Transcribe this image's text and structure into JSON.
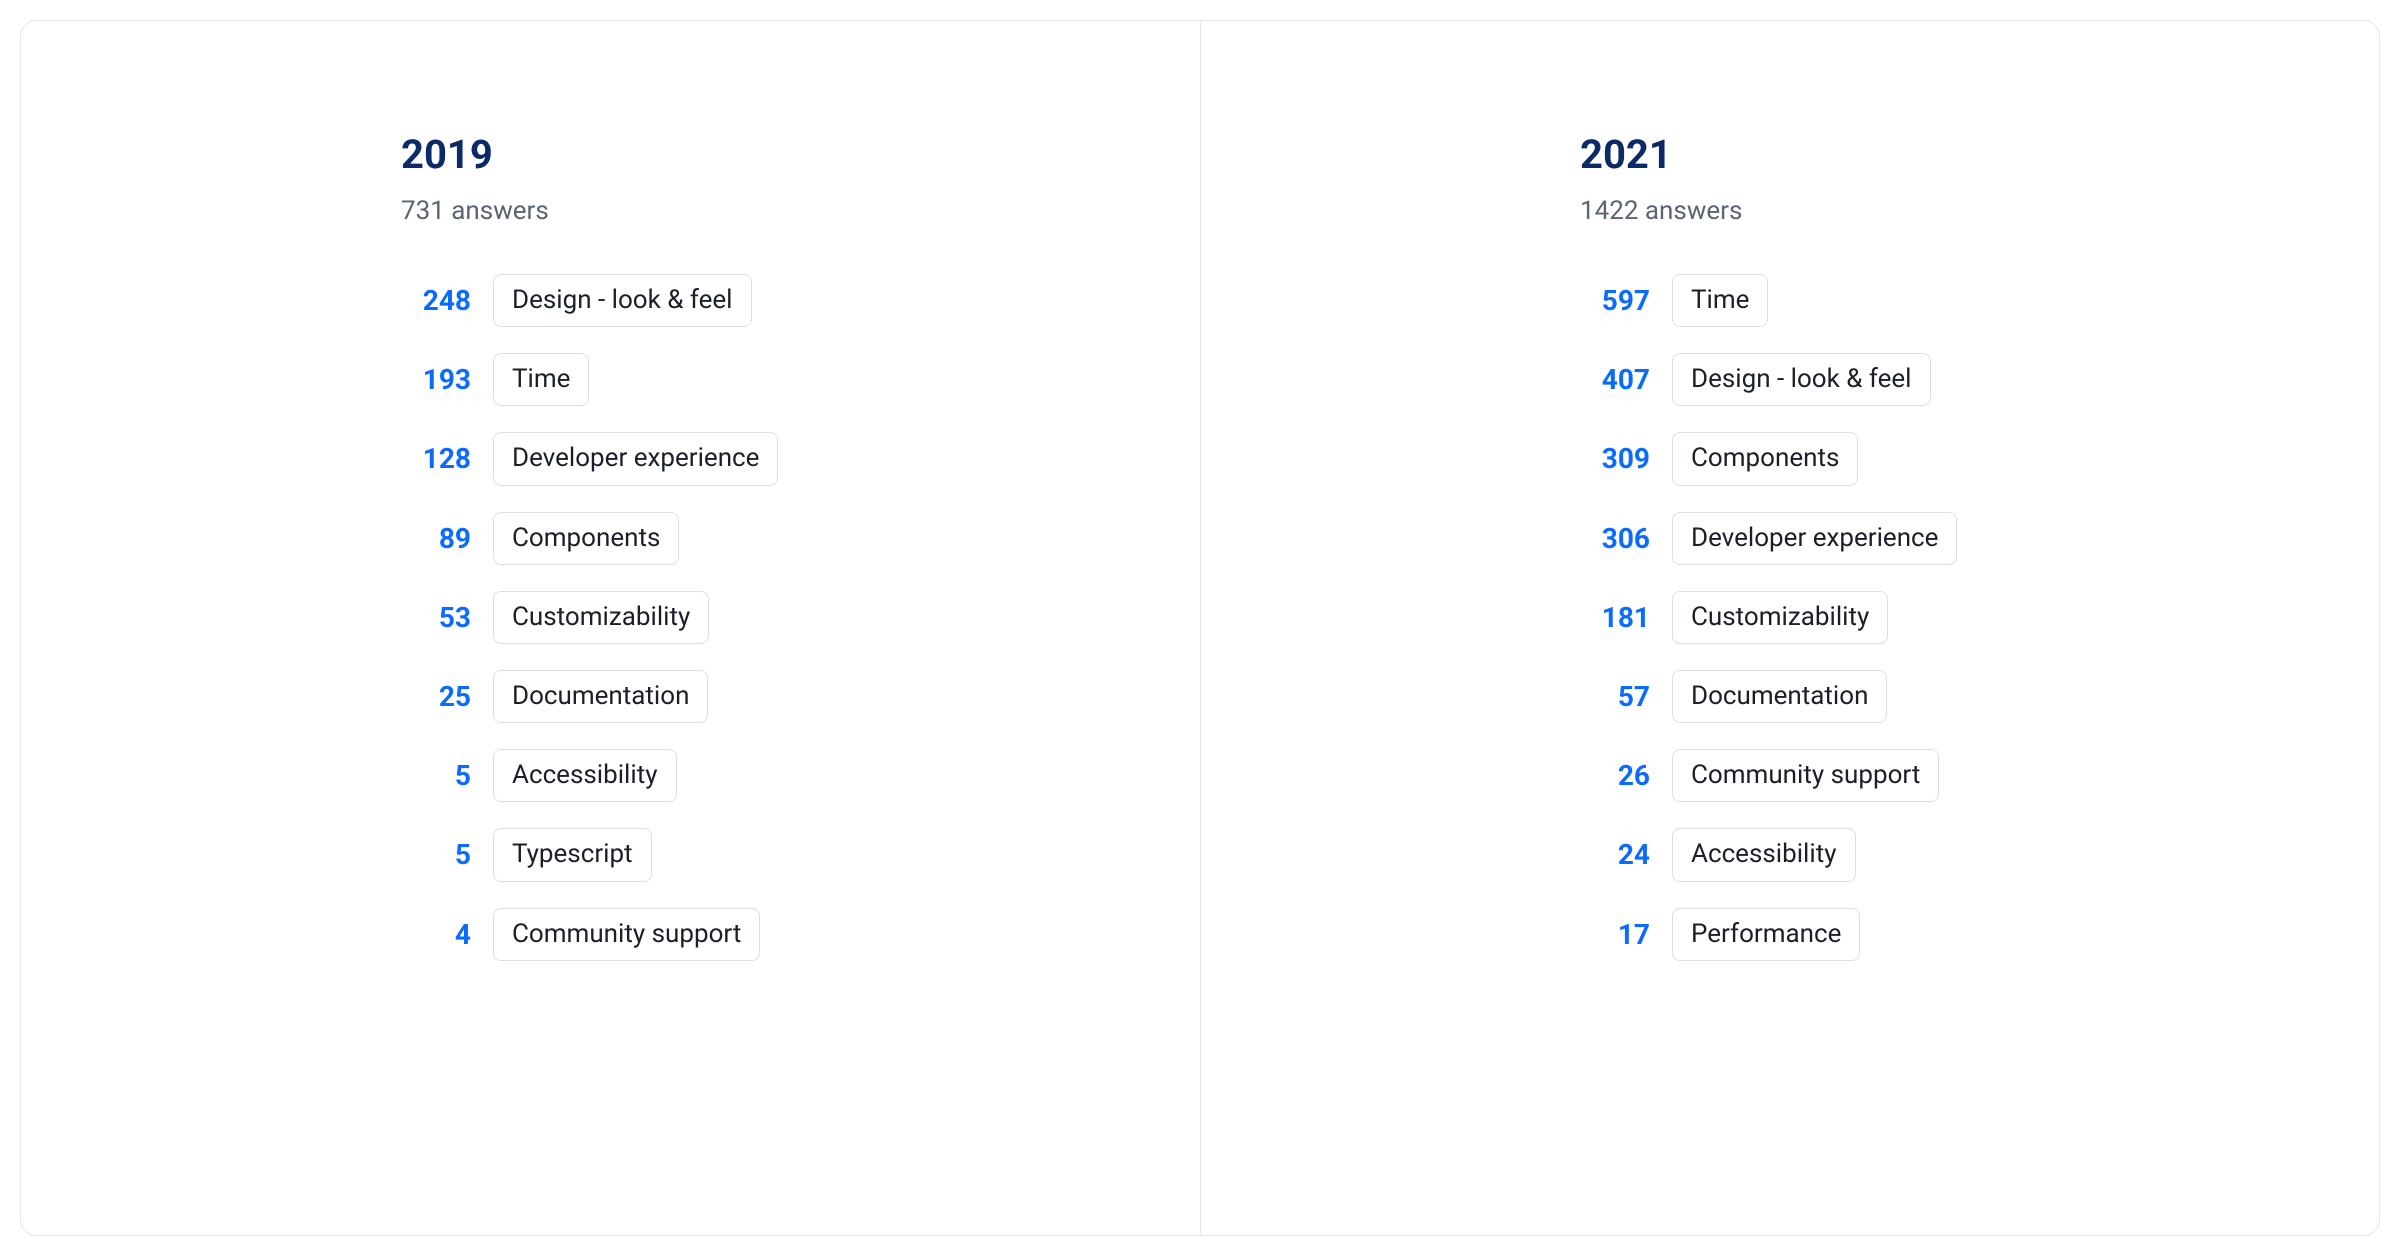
{
  "chart_data": [
    {
      "type": "bar",
      "title": "2019",
      "subtitle": "731 answers",
      "categories": [
        "Design - look & feel",
        "Time",
        "Developer experience",
        "Components",
        "Customizability",
        "Documentation",
        "Accessibility",
        "Typescript",
        "Community support"
      ],
      "values": [
        248,
        193,
        128,
        89,
        53,
        25,
        5,
        5,
        4
      ]
    },
    {
      "type": "bar",
      "title": "2021",
      "subtitle": "1422 answers",
      "categories": [
        "Time",
        "Design - look & feel",
        "Components",
        "Developer experience",
        "Customizability",
        "Documentation",
        "Community support",
        "Accessibility",
        "Performance"
      ],
      "values": [
        597,
        407,
        309,
        306,
        181,
        57,
        26,
        24,
        17
      ]
    }
  ],
  "panels": [
    {
      "title": "2019",
      "subtitle": "731 answers",
      "items": [
        {
          "count": "248",
          "label": "Design - look & feel"
        },
        {
          "count": "193",
          "label": "Time"
        },
        {
          "count": "128",
          "label": "Developer experience"
        },
        {
          "count": "89",
          "label": "Components"
        },
        {
          "count": "53",
          "label": "Customizability"
        },
        {
          "count": "25",
          "label": "Documentation"
        },
        {
          "count": "5",
          "label": "Accessibility"
        },
        {
          "count": "5",
          "label": "Typescript"
        },
        {
          "count": "4",
          "label": "Community support"
        }
      ]
    },
    {
      "title": "2021",
      "subtitle": "1422 answers",
      "items": [
        {
          "count": "597",
          "label": "Time"
        },
        {
          "count": "407",
          "label": "Design - look & feel"
        },
        {
          "count": "309",
          "label": "Components"
        },
        {
          "count": "306",
          "label": "Developer experience"
        },
        {
          "count": "181",
          "label": "Customizability"
        },
        {
          "count": "57",
          "label": "Documentation"
        },
        {
          "count": "26",
          "label": "Community support"
        },
        {
          "count": "24",
          "label": "Accessibility"
        },
        {
          "count": "17",
          "label": "Performance"
        }
      ]
    }
  ]
}
